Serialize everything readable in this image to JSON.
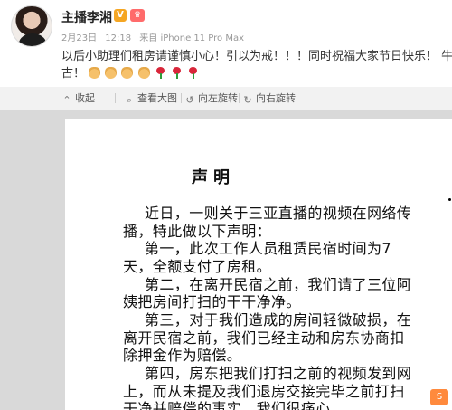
{
  "post": {
    "username": "主播李湘",
    "verified_badge": "V",
    "member_badge": "♛",
    "date": "2月23日",
    "time": "12:18",
    "source": "来自 iPhone 11 Pro Max",
    "text_line1": "以后小助理们租房请谨慎小心！引以为戒！！！同时祝福大家节日快乐！ 牛",
    "text_line2_prefix": "古！"
  },
  "toolbar": {
    "collapse": "收起",
    "view_large": "查看大图",
    "rotate_left": "向左旋转",
    "rotate_right": "向右旋转"
  },
  "document": {
    "title": "声明",
    "lines": [
      "近日，一则关于三亚直播的视频在网络传",
      "播，特此做以下声明：",
      "第一，此次工作人员租赁民宿时间为7",
      "天，全额支付了房租。",
      "第二，在离开民宿之前，我们请了三位阿",
      "姨把房间打扫的干干净净。",
      "第三，对于我们造成的房间轻微破损，在",
      "离开民宿之前，我们已经主动和房东协商扣",
      "除押金作为赔偿。",
      "第四，房东把我们打扫之前的视频发到网",
      "上，而从未提及我们退房交接完毕之前打扫",
      "干净并赔偿的事实，我们很痛心。"
    ]
  },
  "corner_badge": "S"
}
